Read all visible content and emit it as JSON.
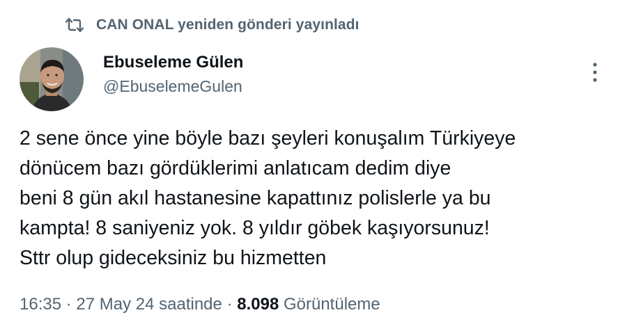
{
  "repost": {
    "icon": "repost-icon",
    "text": "CAN ONAL yeniden gönderi yayınladı"
  },
  "author": {
    "avatar_icon": "avatar",
    "display_name": "Ebuseleme Gülen",
    "handle": "@EbuselemeGulen"
  },
  "more_icon": "more-vertical-icon",
  "tweet": {
    "lines": [
      "2 sene önce yine böyle bazı şeyleri konuşalım Türkiyeye",
      "dönücem bazı gördüklerimi anlatıcam dedim diye",
      "beni 8 gün akıl hastanesine kapattınız polislerle ya bu",
      "kampta! 8 saniyeniz yok. 8 yıldır göbek kaşıyorsunuz!",
      "Sttr olup gideceksiniz bu hizmetten"
    ]
  },
  "meta": {
    "time": "16:35",
    "separator": "·",
    "date": "27 May 24 saatinde",
    "views_count": "8.098",
    "views_label": "Görüntüleme"
  },
  "colors": {
    "text_primary": "#0f1419",
    "text_secondary": "#536471",
    "background": "#ffffff"
  }
}
